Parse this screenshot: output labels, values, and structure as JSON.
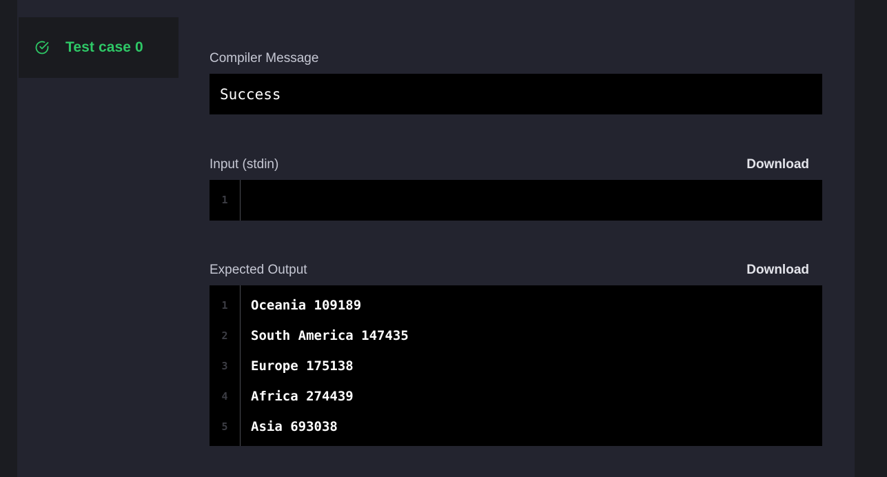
{
  "test_case": {
    "label": "Test case 0",
    "status_icon": "check-circle-icon",
    "status_color": "#2ec866"
  },
  "compiler": {
    "title": "Compiler Message",
    "message": "Success"
  },
  "input": {
    "title": "Input (stdin)",
    "download_label": "Download",
    "line_numbers": [
      "1"
    ],
    "lines": [
      ""
    ]
  },
  "expected": {
    "title": "Expected Output",
    "download_label": "Download",
    "line_numbers": [
      "1",
      "2",
      "3",
      "4",
      "5"
    ],
    "lines": [
      "Oceania 109189",
      "South America 147435",
      "Europe 175138",
      "Africa 274439",
      "Asia 693038"
    ]
  }
}
